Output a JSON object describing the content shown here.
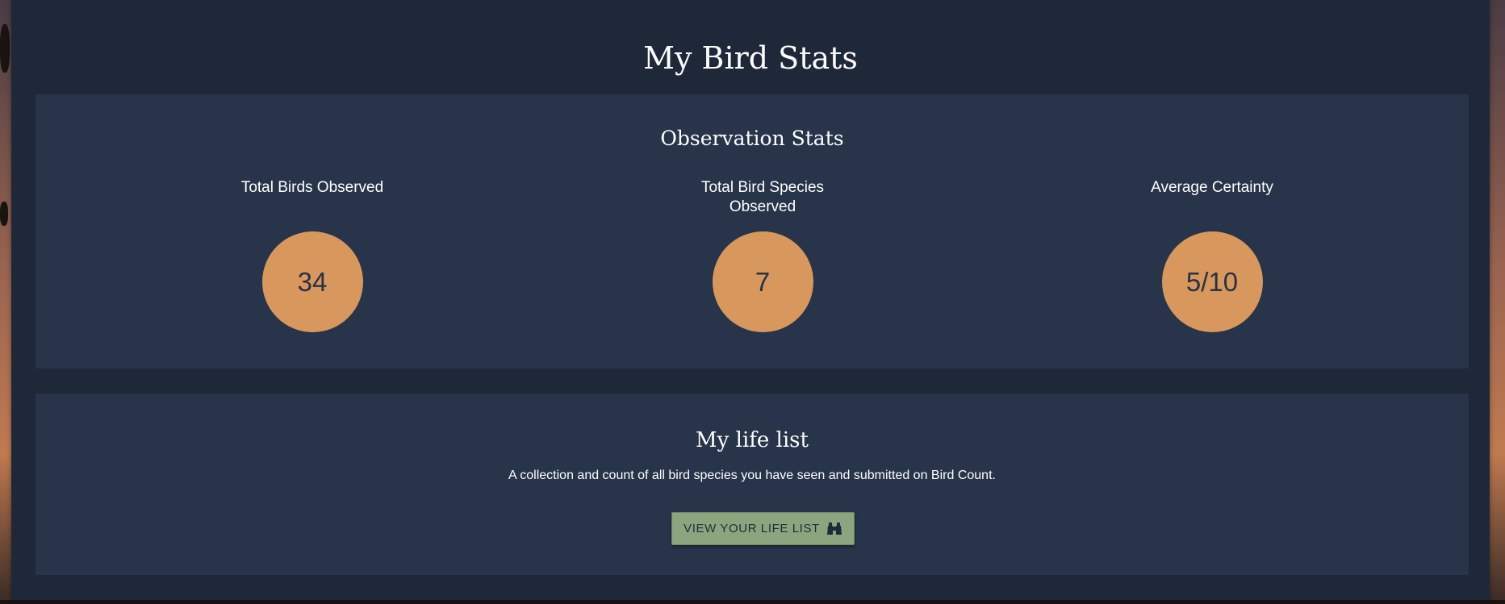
{
  "page": {
    "title": "My Bird Stats"
  },
  "stats": {
    "heading": "Observation Stats",
    "items": [
      {
        "label": "Total Birds Observed",
        "value": "34"
      },
      {
        "label": "Total Bird Species Observed",
        "value": "7"
      },
      {
        "label": "Average Certainty",
        "value": "5/10"
      }
    ]
  },
  "life_list": {
    "heading": "My life list",
    "description": "A collection and count of all bird species you have seen and submitted on Bird Count.",
    "button_label": "VIEW YOUR LIFE LIST",
    "button_icon": "binoculars-icon"
  },
  "colors": {
    "panel_bg": "#1e2839",
    "card_bg": "#273449",
    "stat_circle": "#d8975c",
    "button_bg": "#8da57e"
  }
}
